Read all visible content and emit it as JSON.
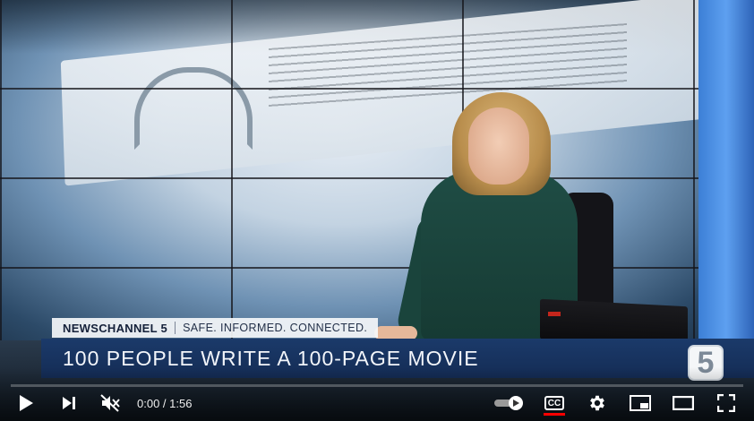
{
  "overlay": {
    "brand": "NEWSCHANNEL 5",
    "slogan": "SAFE. INFORMED. CONNECTED.",
    "headline": "100 PEOPLE WRITE A 100-PAGE MOVIE",
    "logo_digit": "5"
  },
  "player": {
    "time_display": "0:00 / 1:56",
    "progress_fraction": 0,
    "cc_label": "CC",
    "colors": {
      "progress": "#ff0000",
      "cc_indicator": "#ff0000",
      "headline_bar": "#1b3a6a"
    },
    "icons": [
      "play-icon",
      "next-icon",
      "muted-volume-icon",
      "autoplay-toggle-icon",
      "captions-icon",
      "settings-gear-icon",
      "miniplayer-icon",
      "theater-mode-icon",
      "fullscreen-icon"
    ]
  }
}
